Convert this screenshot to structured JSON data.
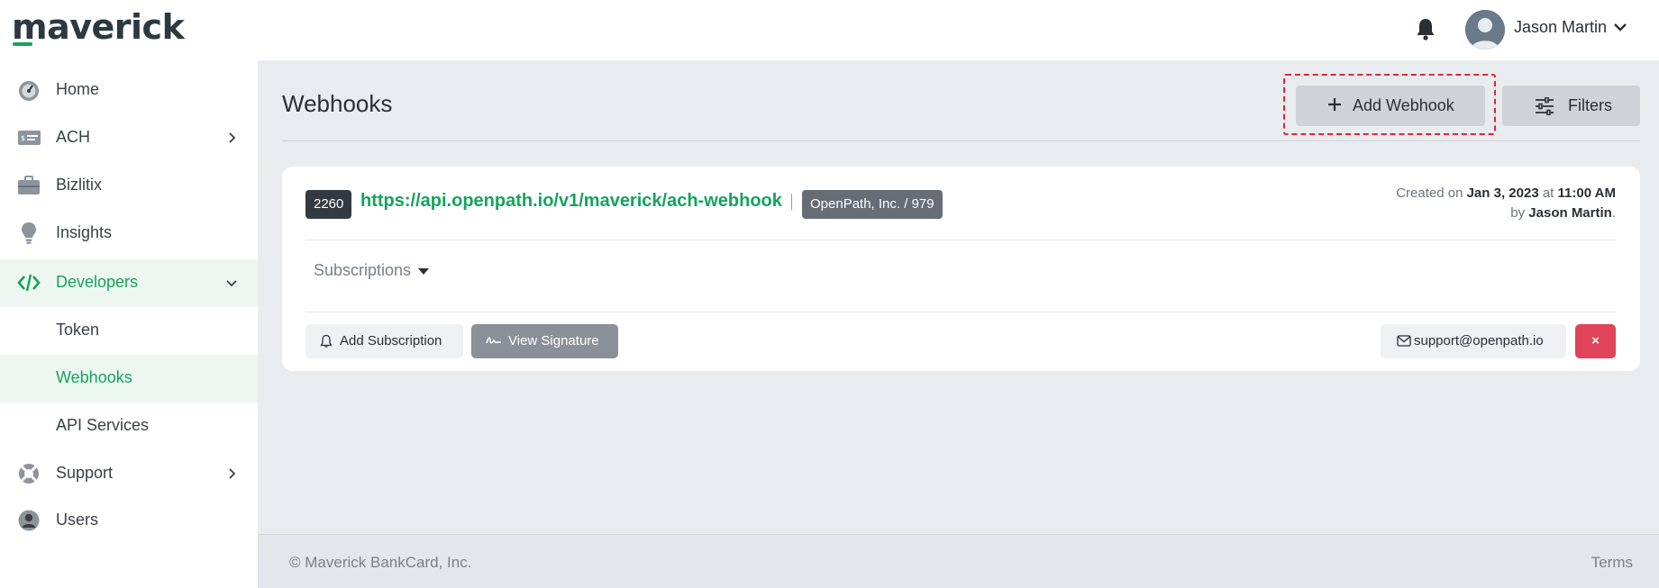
{
  "app": {
    "logo": "maverick"
  },
  "header": {
    "user_name": "Jason Martin",
    "colors": {
      "accent": "#14a35c"
    }
  },
  "sidebar": {
    "items": [
      {
        "label": "Home",
        "icon": "gauge-icon"
      },
      {
        "label": "ACH",
        "icon": "check-card-icon"
      },
      {
        "label": "Bizlitix",
        "icon": "briefcase-icon"
      },
      {
        "label": "Insights",
        "icon": "lightbulb-icon"
      },
      {
        "label": "Developers",
        "icon": "code-icon"
      },
      {
        "label": "Token"
      },
      {
        "label": "Webhooks"
      },
      {
        "label": "API Services"
      },
      {
        "label": "Support",
        "icon": "lifebuoy-icon"
      },
      {
        "label": "Users",
        "icon": "user-circle-icon"
      }
    ]
  },
  "main": {
    "title": "Webhooks",
    "add_button": "Add Webhook",
    "filters_button": "Filters"
  },
  "webhook": {
    "id": "2260",
    "url": "https://api.openpath.io/v1/maverick/ach-webhook",
    "organization": "OpenPath, Inc. / 979",
    "created_prefix": "Created on",
    "created_date": "Jan 3, 2023",
    "created_at_word": "at",
    "created_time": "11:00 AM",
    "by_word": "by",
    "created_by": "Jason Martin",
    "subscriptions_label": "Subscriptions",
    "add_subscription": "Add Subscription",
    "view_signature": "View Signature",
    "support_email": "support@openpath.io",
    "delete_symbol": "×"
  },
  "footer": {
    "copyright": "© Maverick BankCard, Inc.",
    "terms": "Terms"
  }
}
